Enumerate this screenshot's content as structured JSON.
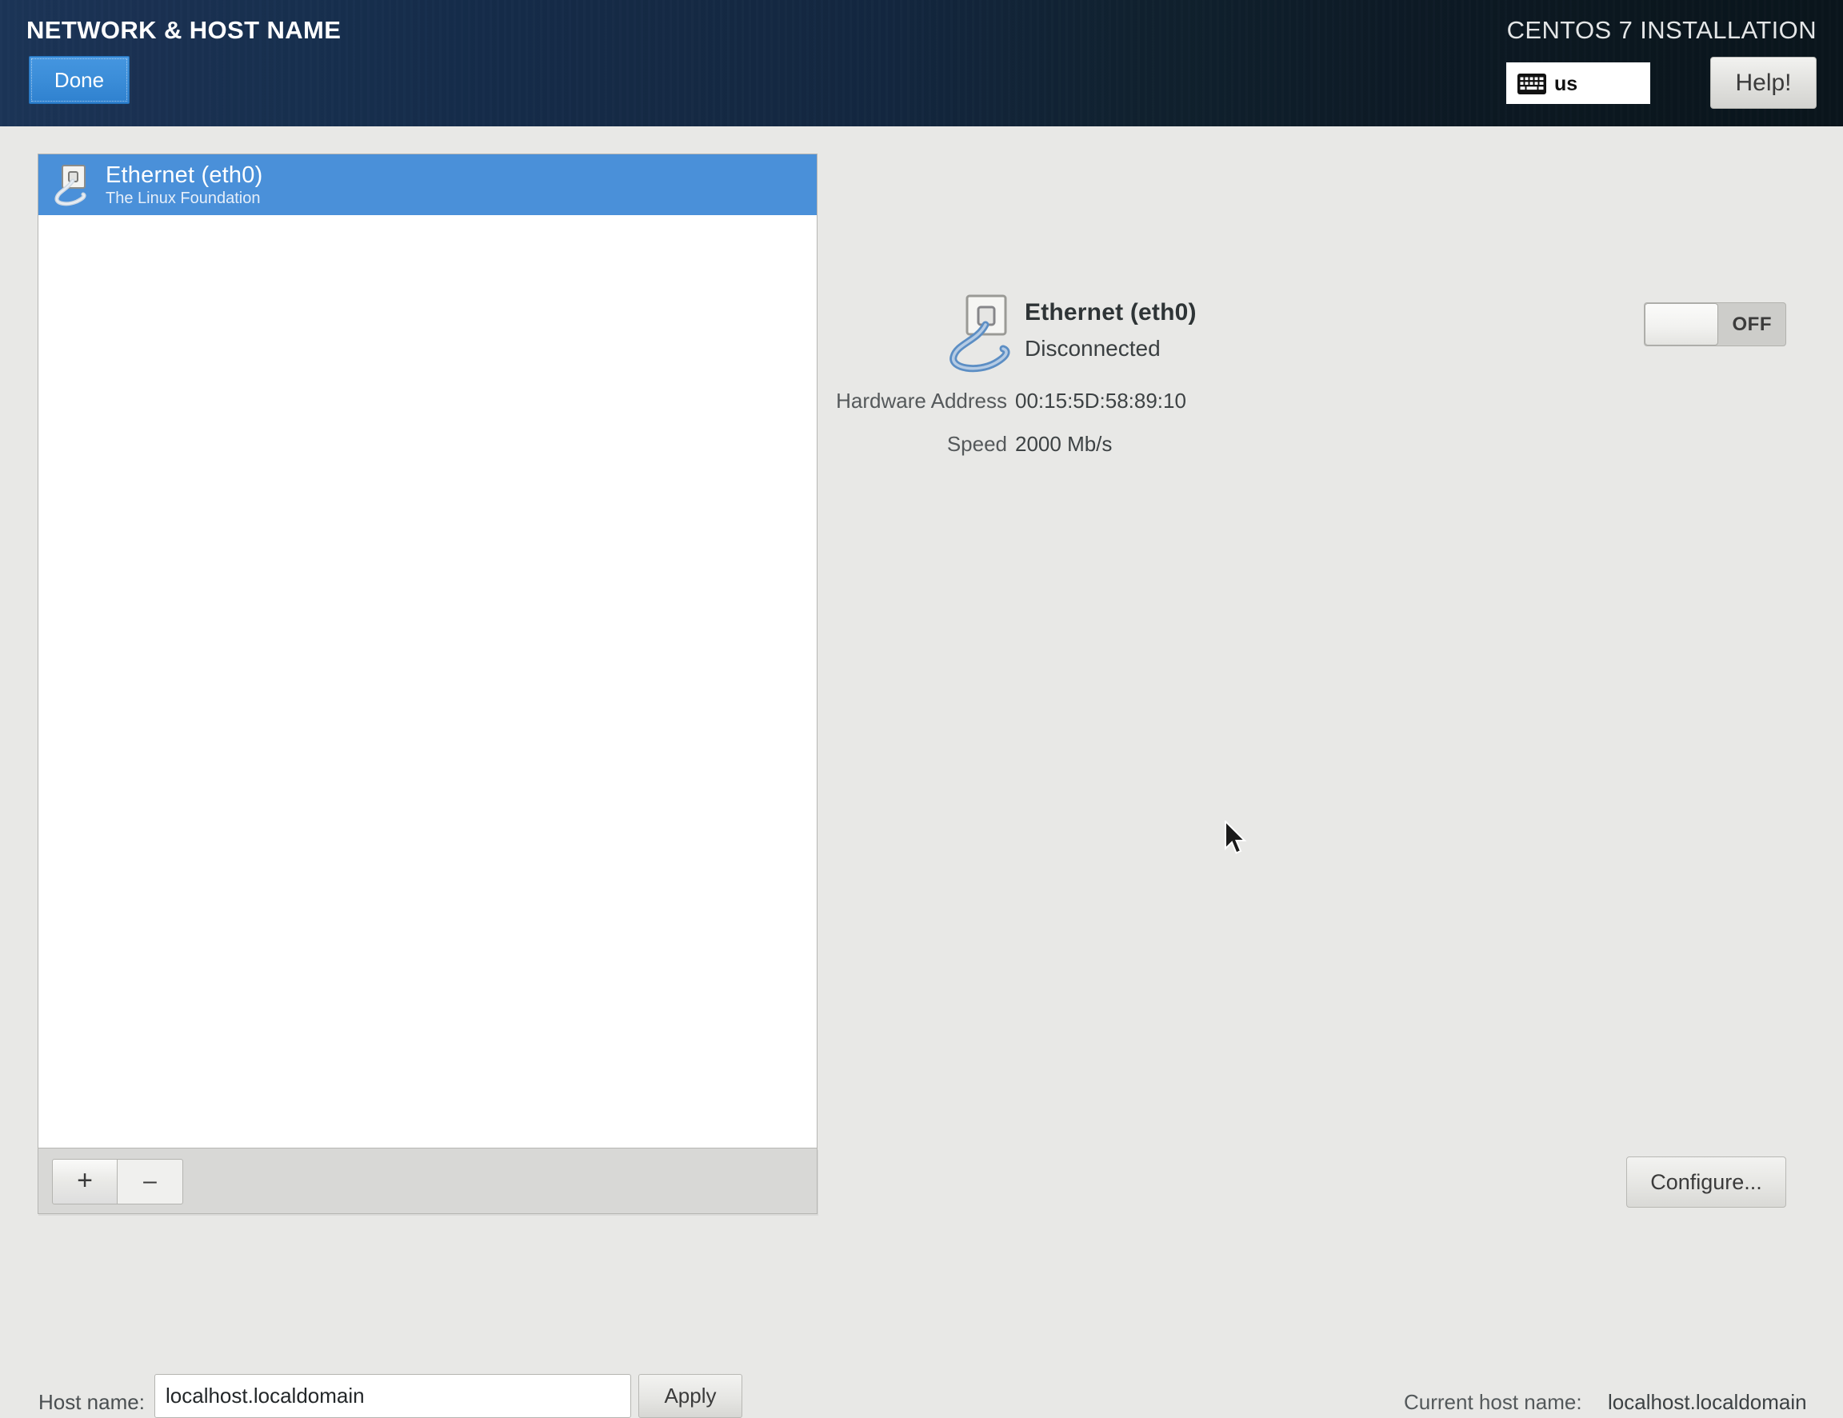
{
  "header": {
    "page_title": "NETWORK & HOST NAME",
    "done_label": "Done",
    "install_title": "CENTOS 7 INSTALLATION",
    "keyboard_layout": "us",
    "keyboard_icon": "keyboard-icon",
    "help_label": "Help!"
  },
  "device_list": {
    "items": [
      {
        "name": "Ethernet (eth0)",
        "subtitle": "The Linux Foundation",
        "icon": "ethernet-icon",
        "selected": true
      }
    ],
    "add_label": "+",
    "remove_label": "–"
  },
  "detail": {
    "icon": "ethernet-icon",
    "name": "Ethernet (eth0)",
    "status": "Disconnected",
    "rows": [
      {
        "label": "Hardware Address",
        "value": "00:15:5D:58:89:10"
      },
      {
        "label": "Speed",
        "value": "2000 Mb/s"
      }
    ],
    "toggle_state": "OFF",
    "configure_label": "Configure..."
  },
  "footer": {
    "hostname_label": "Host name:",
    "hostname_value": "localhost.localdomain",
    "hostname_placeholder": "localhost.localdomain",
    "apply_label": "Apply",
    "current_hostname_label": "Current host name:",
    "current_hostname_value": "localhost.localdomain"
  },
  "colors": {
    "accent_blue": "#4a90d9",
    "done_button": "#3b8dd8",
    "header_gradient_start": "#1b3557",
    "header_gradient_end": "#0a151c",
    "body_background": "#e8e8e6"
  }
}
